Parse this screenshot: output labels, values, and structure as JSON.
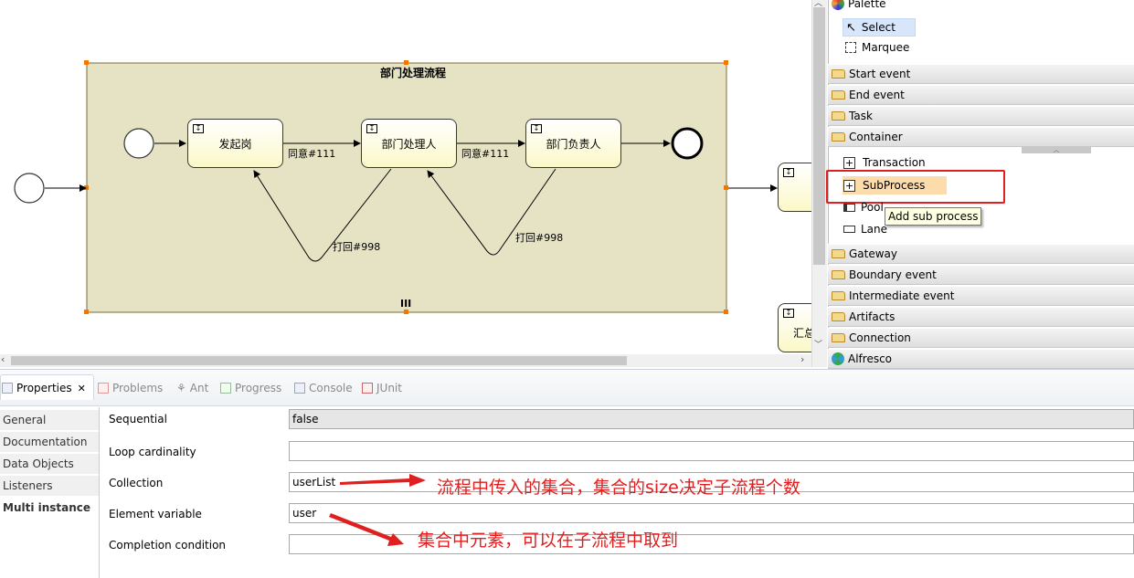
{
  "diagram": {
    "subprocess_title": "部门处理流程",
    "tasks": [
      {
        "label": "发起岗"
      },
      {
        "label": "部门处理人"
      },
      {
        "label": "部门负责人"
      },
      {
        "label": "汇总"
      }
    ],
    "flows": {
      "agree_1": "同意#111",
      "agree_2": "同意#111",
      "reject_1": "打回#998",
      "reject_2": "打回#998"
    },
    "multi_instance_marker": "III"
  },
  "palette": {
    "title": "Palette",
    "tools": [
      {
        "label": "Select"
      },
      {
        "label": "Marquee"
      }
    ],
    "drawers": [
      {
        "label": "Start event"
      },
      {
        "label": "End event"
      },
      {
        "label": "Task"
      },
      {
        "label": "Container"
      },
      {
        "label": "Gateway"
      },
      {
        "label": "Boundary event"
      },
      {
        "label": "Intermediate event"
      },
      {
        "label": "Artifacts"
      },
      {
        "label": "Connection"
      },
      {
        "label": "Alfresco"
      }
    ],
    "container_items": [
      {
        "label": "Transaction"
      },
      {
        "label": "SubProcess"
      },
      {
        "label": "Pool"
      },
      {
        "label": "Lane"
      }
    ],
    "tooltip": "Add sub process"
  },
  "tabs": [
    {
      "label": "Properties"
    },
    {
      "label": "Problems"
    },
    {
      "label": "Ant"
    },
    {
      "label": "Progress"
    },
    {
      "label": "Console"
    },
    {
      "label": "JUnit"
    }
  ],
  "sidebar": [
    {
      "label": "General"
    },
    {
      "label": "Documentation"
    },
    {
      "label": "Data Objects"
    },
    {
      "label": "Listeners"
    },
    {
      "label": "Multi instance"
    }
  ],
  "properties": [
    {
      "label": "Sequential",
      "value": "false"
    },
    {
      "label": "Loop cardinality",
      "value": ""
    },
    {
      "label": "Collection",
      "value": "userList"
    },
    {
      "label": "Element variable",
      "value": "user"
    },
    {
      "label": "Completion condition",
      "value": ""
    }
  ],
  "annotations": {
    "collection_note": "流程中传入的集合，集合的size决定子流程个数",
    "element_note": "集合中元素，可以在子流程中取到"
  },
  "colors": {
    "subprocess_fill": "#e6e3c5",
    "annotation_red": "#e02020",
    "selection_orange": "#f07800"
  }
}
